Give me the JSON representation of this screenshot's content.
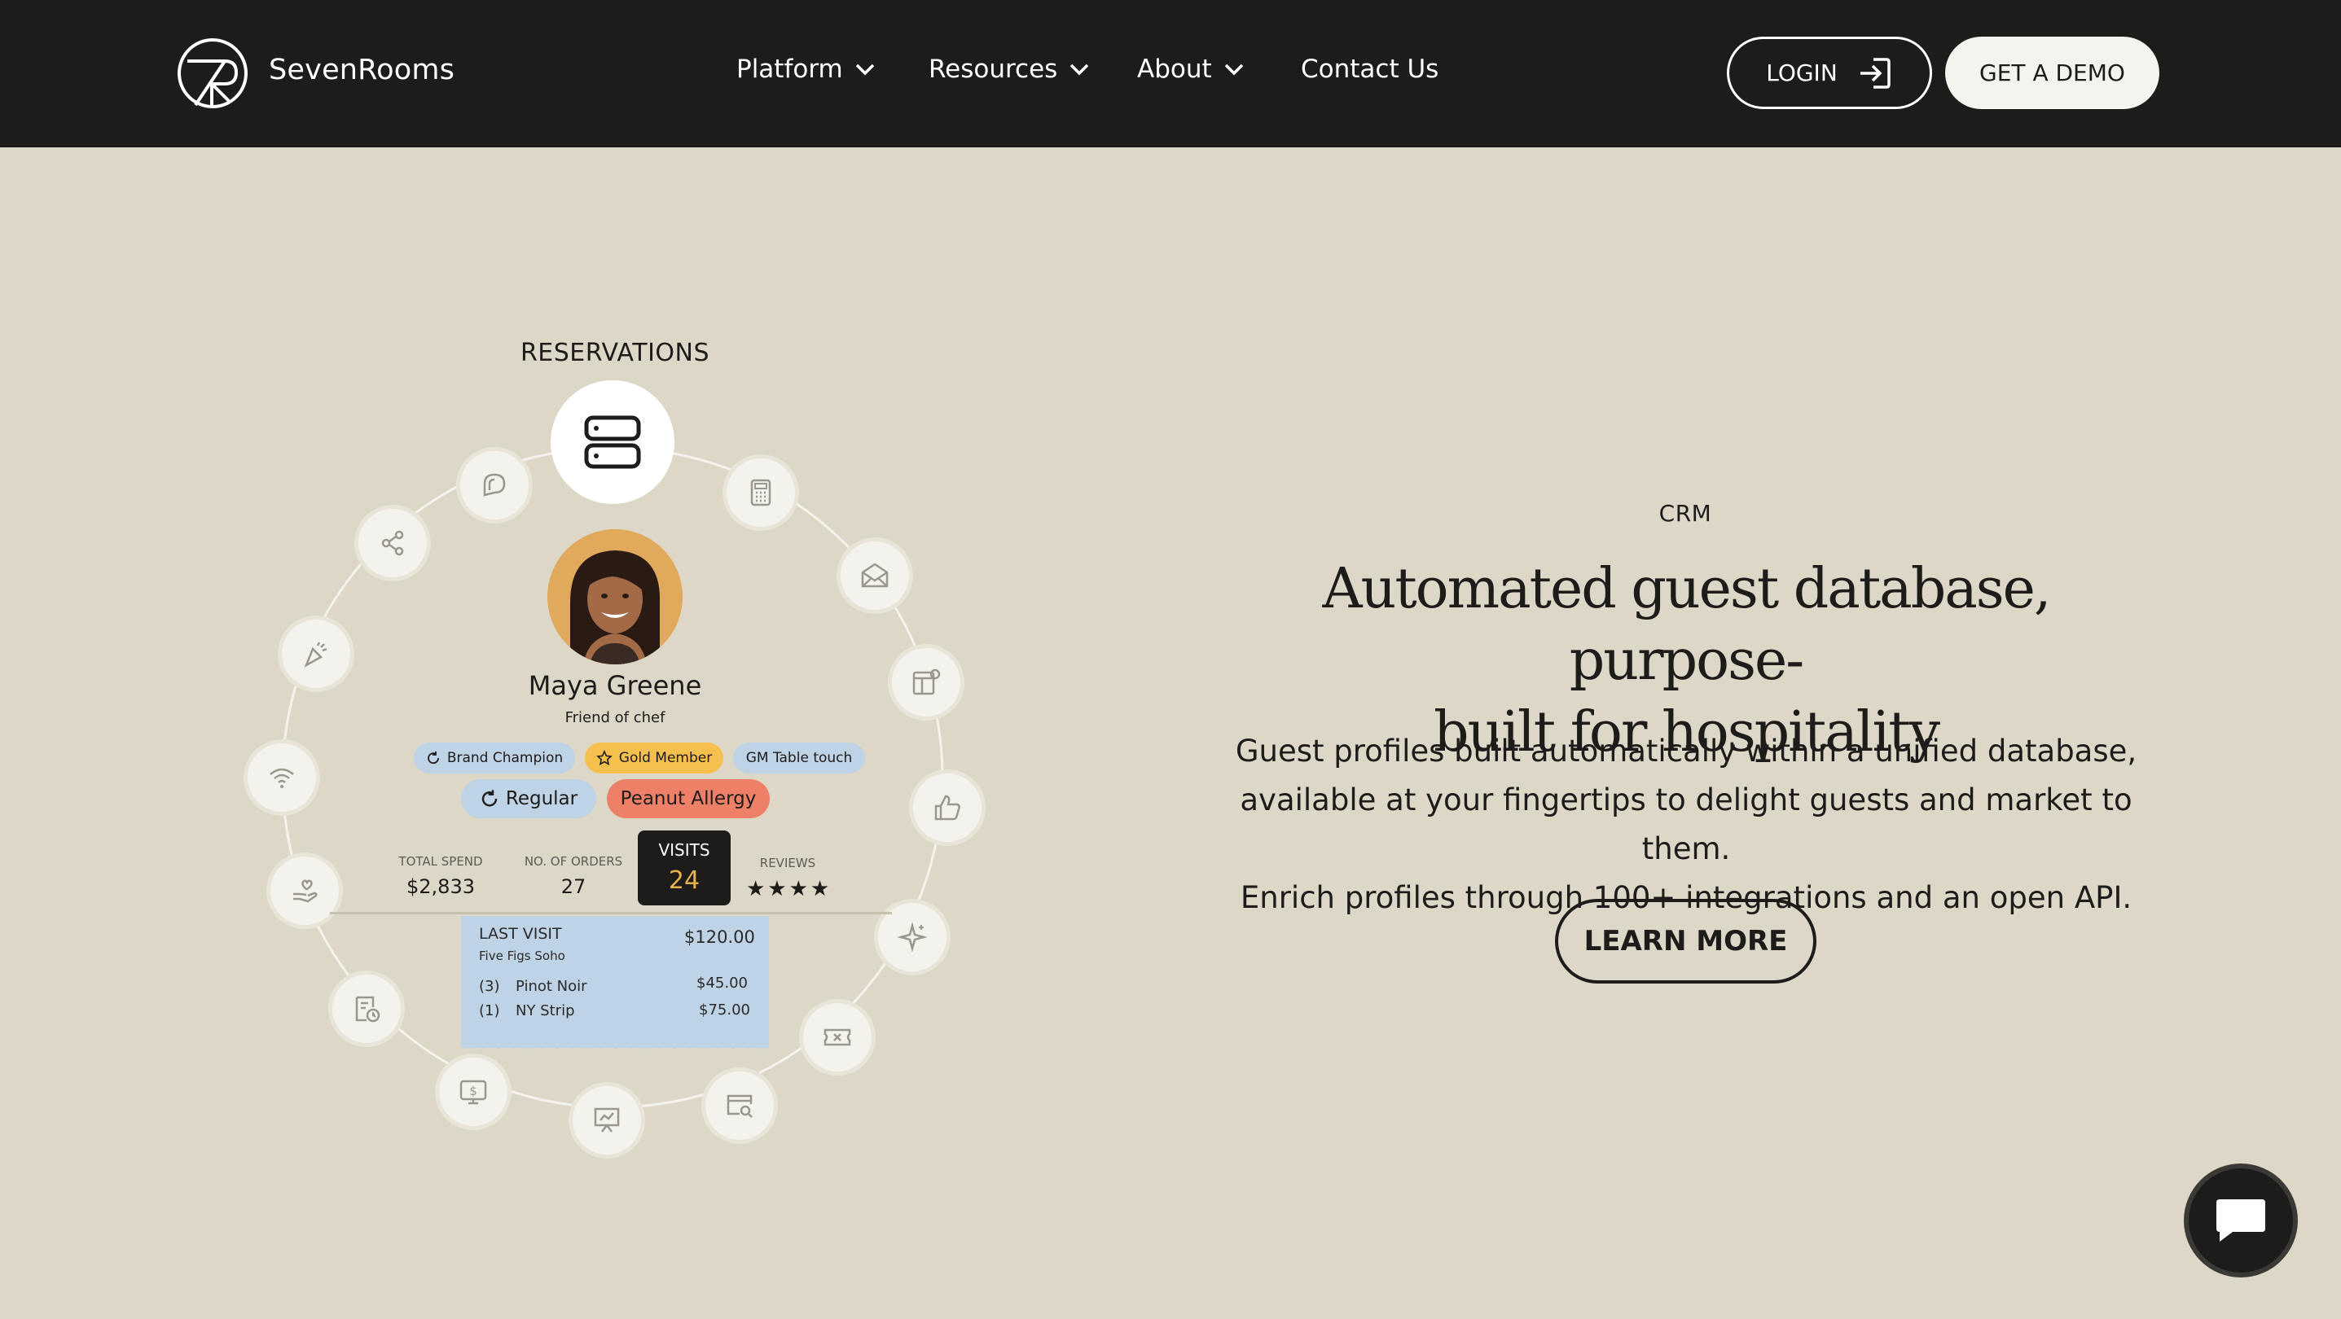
{
  "header": {
    "brand": "SevenRooms",
    "nav": [
      {
        "label": "Platform",
        "dropdown": true
      },
      {
        "label": "Resources",
        "dropdown": true
      },
      {
        "label": "About",
        "dropdown": true
      },
      {
        "label": "Contact Us",
        "dropdown": false
      }
    ],
    "login_label": "LOGIN",
    "demo_label": "GET A DEMO"
  },
  "illustration": {
    "ring_label": "RESERVATIONS",
    "guest": {
      "name": "Maya Greene",
      "subtitle": "Friend of chef"
    },
    "tags": [
      "Brand Champion",
      "Gold Member",
      "GM Table touch"
    ],
    "tags_large": [
      "Regular",
      "Peanut Allergy"
    ],
    "stats": {
      "total_spend_label": "TOTAL SPEND",
      "total_spend": "$2,833",
      "orders_label": "NO. OF ORDERS",
      "orders": "27",
      "visits_label": "VISITS",
      "visits": "24",
      "reviews_label": "REVIEWS",
      "reviews_stars": "★★★★"
    },
    "last_visit": {
      "label": "LAST VISIT",
      "venue": "Five Figs Soho",
      "total": "$120.00",
      "items": [
        {
          "qty": "(3)",
          "name": "Pinot Noir",
          "price": "$45.00"
        },
        {
          "qty": "(1)",
          "name": "NY Strip",
          "price": "$75.00"
        }
      ]
    },
    "ring_icons": [
      "chat-icon",
      "share-icon",
      "celebration-icon",
      "wifi-icon",
      "hand-heart-icon",
      "receipt-clock-icon",
      "payment-icon",
      "presentation-icon",
      "search-window-icon",
      "ticket-icon",
      "sparkle-icon",
      "thumbs-up-icon",
      "dashboard-icon",
      "mail-icon",
      "calculator-icon"
    ]
  },
  "content": {
    "eyebrow": "CRM",
    "headline_line1": "Automated guest database, purpose-",
    "headline_line2": "built for hospitality",
    "body_line1": "Guest profiles built automatically within a unified database,",
    "body_line2": "available at your fingertips to delight guests and market to them.",
    "body_line3": "Enrich profiles through 100+ integrations and an open API.",
    "cta_label": "LEARN MORE"
  },
  "colors": {
    "header_bg": "#1d1c1a",
    "page_bg": "#dcd7c7",
    "gold_tag": "#f5c04e",
    "allergy_tag": "#ef8068",
    "blue_tag": "#bfd3e6"
  }
}
